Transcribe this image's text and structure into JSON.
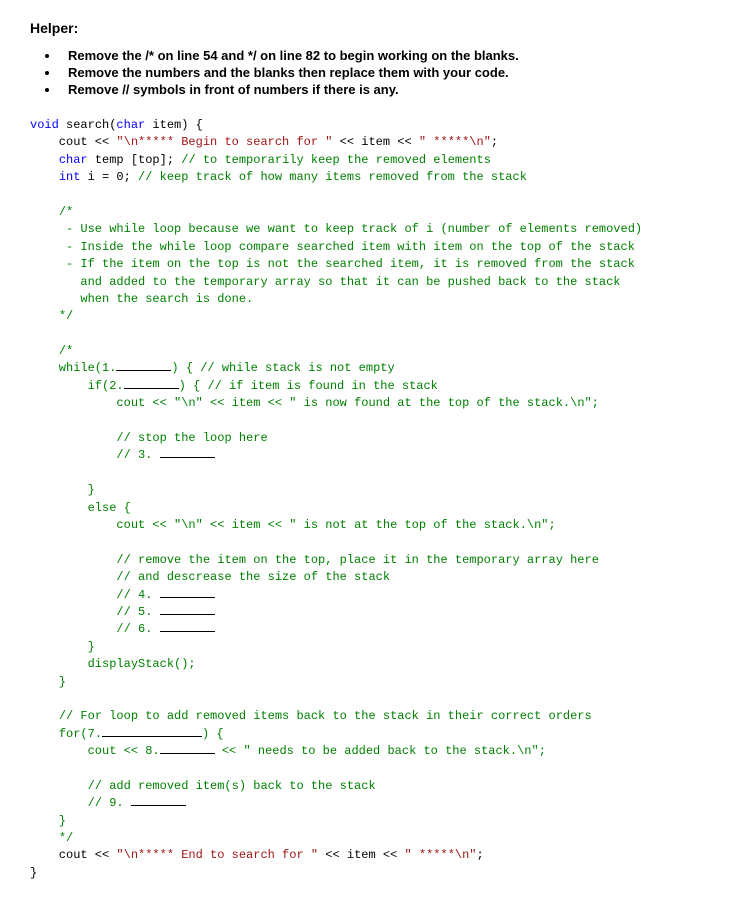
{
  "helper": {
    "title": "Helper:",
    "items": [
      "Remove the /* on line 54 and */ on line 82 to begin working on the blanks.",
      "Remove the numbers and the blanks then replace them with your code.",
      "Remove // symbols in front of numbers if there is any."
    ]
  },
  "code": {
    "l1_void": "void",
    "l1_search": " search(",
    "l1_char": "char",
    "l1_item": " item) {",
    "l2_cout": "    cout << ",
    "l2_str1": "\"\\n***** Begin to search for \"",
    "l2_mid": " << item << ",
    "l2_str2": "\" *****\\n\"",
    "l2_semi": ";",
    "l3_char": "char",
    "l3_temp": " temp [top]; ",
    "l3_com": "// to temporarily keep the removed elements",
    "l4_int": "int",
    "l4_i": " i = 0; ",
    "l4_com": "// keep track of how many items removed from the stack",
    "cb1_open": "/*",
    "cb1_l1": "     - Use while loop because we want to keep track of i (number of elements removed)",
    "cb1_l2": "     - Inside the while loop compare searched item with item on the top of the stack",
    "cb1_l3": "     - If the item on the top is not the searched item, it is removed from the stack",
    "cb1_l4": "       and added to the temporary array so that it can be pushed back to the stack",
    "cb1_l5": "       when the search is done.",
    "cb1_close": "*/",
    "cb2_open": "/*",
    "while_pre": "    while(1.",
    "while_post": ") { ",
    "while_com": "// while stack is not empty",
    "if_pre": "        if(2.",
    "if_post": ") { ",
    "if_com": "// if item is found in the stack",
    "found_cout": "            cout << ",
    "found_s1": "\"\\n\"",
    "found_mid": " << item << ",
    "found_s2": "\" is now found at the top of the stack.\\n\"",
    "found_semi": ";",
    "stop_com": "// stop the loop here",
    "c3": "// 3. ",
    "close_if": "        }",
    "else_kw": "else",
    "else_pre": "        ",
    "else_brace": " {",
    "notfound_cout": "            cout << ",
    "notfound_s1": "\"\\n\"",
    "notfound_mid": " << item << ",
    "notfound_s2": "\" is not at the top of the stack.\\n\"",
    "notfound_semi": ";",
    "rem_com1": "// remove the item on the top, place it in the temporary array here",
    "rem_com2": "// and descrease the size of the stack",
    "c4": "// 4. ",
    "c5": "// 5. ",
    "c6": "// 6. ",
    "close_else": "        }",
    "disp": "        displayStack();",
    "close_while": "    }",
    "for_com": "// For loop to add removed items back to the stack in their correct orders",
    "for_kw": "for",
    "for_pre": "    ",
    "for_open": "(7.",
    "for_close": ") {",
    "for_cout": "        cout << 8.",
    "for_mid": " << ",
    "for_str": "\" needs to be added back to the stack.\\n\"",
    "for_semi": ";",
    "add_com": "// add removed item(s) back to the stack",
    "c9": "// 9. ",
    "close_for": "    }",
    "cb2_close": "*/",
    "end_cout": "    cout << ",
    "end_s1": "\"\\n***** End to search for \"",
    "end_mid": " << item << ",
    "end_s2": "\" *****\\n\"",
    "end_semi": ";",
    "close_fn": "}"
  }
}
